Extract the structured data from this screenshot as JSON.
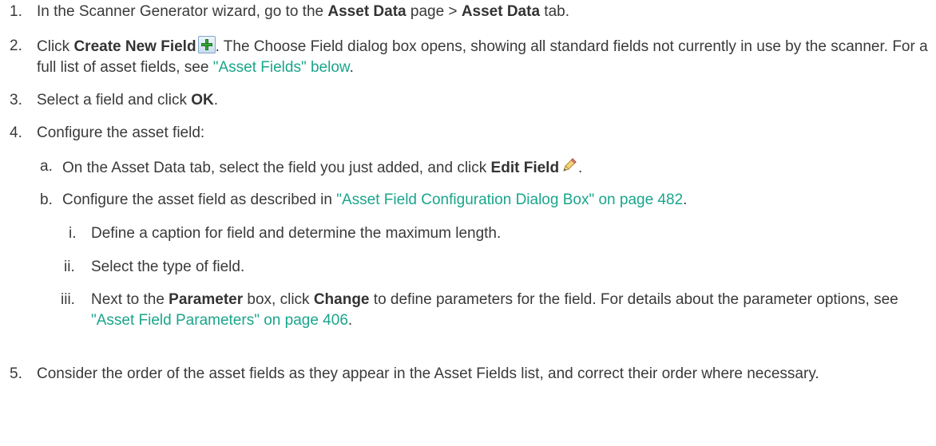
{
  "steps": [
    {
      "marker": "1.",
      "segments": [
        {
          "text": "In the Scanner Generator wizard, go to the "
        },
        {
          "text": "Asset Data",
          "bold": true
        },
        {
          "text": " page > "
        },
        {
          "text": "Asset Data",
          "bold": true
        },
        {
          "text": " tab."
        }
      ]
    },
    {
      "marker": "2.",
      "segments": [
        {
          "text": "Click "
        },
        {
          "text": "Create New Field",
          "bold": true
        },
        {
          "icon": "plus-icon"
        },
        {
          "text": ". The Choose Field dialog box opens, showing all standard fields not currently in use by the scanner. For a full list of asset fields, see "
        },
        {
          "text": "\"Asset Fields\" below",
          "link": true
        },
        {
          "text": "."
        }
      ]
    },
    {
      "marker": "3.",
      "segments": [
        {
          "text": "Select a field and click "
        },
        {
          "text": "OK",
          "bold": true
        },
        {
          "text": "."
        }
      ]
    },
    {
      "marker": "4.",
      "segments": [
        {
          "text": "Configure the asset field:"
        }
      ]
    },
    {
      "marker": "a.",
      "segments": [
        {
          "text": "On the Asset Data tab, select the field you just added, and click "
        },
        {
          "text": "Edit Field",
          "bold": true
        },
        {
          "icon": "pencil-icon"
        },
        {
          "text": "."
        }
      ]
    },
    {
      "marker": "b.",
      "segments": [
        {
          "text": "Configure the asset field as described in "
        },
        {
          "text": "\"Asset Field Configuration Dialog Box\" on page 482",
          "link": true
        },
        {
          "text": "."
        }
      ]
    },
    {
      "marker": "i.",
      "segments": [
        {
          "text": "Define a caption for field and determine the maximum length."
        }
      ]
    },
    {
      "marker": "ii.",
      "segments": [
        {
          "text": "Select the type of field."
        }
      ]
    },
    {
      "marker": "iii.",
      "segments": [
        {
          "text": "Next to the "
        },
        {
          "text": "Parameter",
          "bold": true
        },
        {
          "text": " box, click "
        },
        {
          "text": "Change",
          "bold": true
        },
        {
          "text": " to define parameters for the field. For details about the parameter options, see "
        },
        {
          "text": "\"Asset Field Parameters\" on page 406",
          "link": true
        },
        {
          "text": "."
        }
      ]
    },
    {
      "marker": "5.",
      "segments": [
        {
          "text": "Consider the order of the asset fields as they appear in the Asset Fields list, and correct their order where necessary."
        }
      ]
    }
  ]
}
